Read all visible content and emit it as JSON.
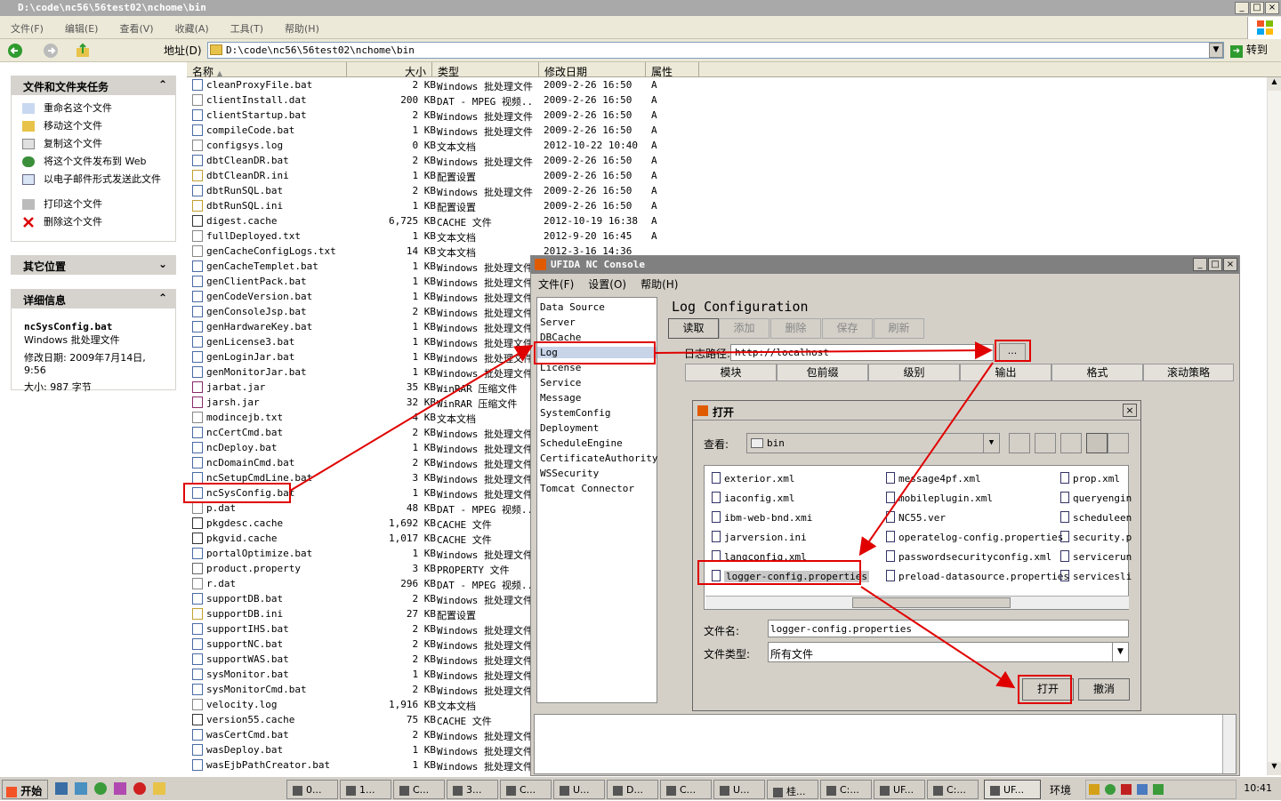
{
  "explorer": {
    "title": "D:\\code\\nc56\\56test02\\nchome\\bin",
    "menu": [
      "文件(F)",
      "编辑(E)",
      "查看(V)",
      "收藏(A)",
      "工具(T)",
      "帮助(H)"
    ],
    "address_label": "地址(D)",
    "address": "D:\\code\\nc56\\56test02\\nchome\\bin",
    "go_label": "转到",
    "tasks_title": "文件和文件夹任务",
    "tasks": [
      "重命名这个文件",
      "移动这个文件",
      "复制这个文件",
      "将这个文件发布到 Web",
      "以电子邮件形式发送此文件",
      "打印这个文件",
      "删除这个文件"
    ],
    "other_title": "其它位置",
    "details_title": "详细信息",
    "details_name": "ncSysConfig.bat",
    "details_type": "Windows 批处理文件",
    "details_modified": "修改日期: 2009年7月14日, 9:56",
    "details_size": "大小: 987 字节",
    "columns": [
      "名称",
      "大小",
      "类型",
      "修改日期",
      "属性"
    ],
    "files": [
      {
        "n": "cleanProxyFile.bat",
        "s": "2 KB",
        "t": "Windows 批处理文件",
        "d": "2009-2-26 16:50",
        "a": "A"
      },
      {
        "n": "clientInstall.dat",
        "s": "200 KB",
        "t": "DAT - MPEG 视频...",
        "d": "2009-2-26 16:50",
        "a": "A"
      },
      {
        "n": "clientStartup.bat",
        "s": "2 KB",
        "t": "Windows 批处理文件",
        "d": "2009-2-26 16:50",
        "a": "A"
      },
      {
        "n": "compileCode.bat",
        "s": "1 KB",
        "t": "Windows 批处理文件",
        "d": "2009-2-26 16:50",
        "a": "A"
      },
      {
        "n": "configsys.log",
        "s": "0 KB",
        "t": "文本文档",
        "d": "2012-10-22 10:40",
        "a": "A"
      },
      {
        "n": "dbtCleanDR.bat",
        "s": "2 KB",
        "t": "Windows 批处理文件",
        "d": "2009-2-26 16:50",
        "a": "A"
      },
      {
        "n": "dbtCleanDR.ini",
        "s": "1 KB",
        "t": "配置设置",
        "d": "2009-2-26 16:50",
        "a": "A"
      },
      {
        "n": "dbtRunSQL.bat",
        "s": "2 KB",
        "t": "Windows 批处理文件",
        "d": "2009-2-26 16:50",
        "a": "A"
      },
      {
        "n": "dbtRunSQL.ini",
        "s": "1 KB",
        "t": "配置设置",
        "d": "2009-2-26 16:50",
        "a": "A"
      },
      {
        "n": "digest.cache",
        "s": "6,725 KB",
        "t": "CACHE 文件",
        "d": "2012-10-19 16:38",
        "a": "A"
      },
      {
        "n": "fullDeployed.txt",
        "s": "1 KB",
        "t": "文本文档",
        "d": "2012-9-20 16:45",
        "a": "A"
      },
      {
        "n": "genCacheConfigLogs.txt",
        "s": "14 KB",
        "t": "文本文档",
        "d": "2012-3-16 14:36",
        "a": ""
      },
      {
        "n": "genCacheTemplet.bat",
        "s": "1 KB",
        "t": "Windows 批处理文件",
        "d": "",
        "a": ""
      },
      {
        "n": "genClientPack.bat",
        "s": "1 KB",
        "t": "Windows 批处理文件",
        "d": "",
        "a": ""
      },
      {
        "n": "genCodeVersion.bat",
        "s": "1 KB",
        "t": "Windows 批处理文件",
        "d": "",
        "a": ""
      },
      {
        "n": "genConsoleJsp.bat",
        "s": "2 KB",
        "t": "Windows 批处理文件",
        "d": "",
        "a": ""
      },
      {
        "n": "genHardwareKey.bat",
        "s": "1 KB",
        "t": "Windows 批处理文件",
        "d": "",
        "a": ""
      },
      {
        "n": "genLicense3.bat",
        "s": "1 KB",
        "t": "Windows 批处理文件",
        "d": "",
        "a": ""
      },
      {
        "n": "genLoginJar.bat",
        "s": "1 KB",
        "t": "Windows 批处理文件",
        "d": "",
        "a": ""
      },
      {
        "n": "genMonitorJar.bat",
        "s": "1 KB",
        "t": "Windows 批处理文件",
        "d": "",
        "a": ""
      },
      {
        "n": "jarbat.jar",
        "s": "35 KB",
        "t": "WinRAR 压缩文件",
        "d": "",
        "a": ""
      },
      {
        "n": "jarsh.jar",
        "s": "32 KB",
        "t": "WinRAR 压缩文件",
        "d": "",
        "a": ""
      },
      {
        "n": "modincejb.txt",
        "s": "4 KB",
        "t": "文本文档",
        "d": "",
        "a": ""
      },
      {
        "n": "ncCertCmd.bat",
        "s": "2 KB",
        "t": "Windows 批处理文件",
        "d": "",
        "a": ""
      },
      {
        "n": "ncDeploy.bat",
        "s": "1 KB",
        "t": "Windows 批处理文件",
        "d": "",
        "a": ""
      },
      {
        "n": "ncDomainCmd.bat",
        "s": "2 KB",
        "t": "Windows 批处理文件",
        "d": "",
        "a": ""
      },
      {
        "n": "ncSetupCmdLine.bat",
        "s": "3 KB",
        "t": "Windows 批处理文件",
        "d": "",
        "a": ""
      },
      {
        "n": "ncSysConfig.bat",
        "s": "1 KB",
        "t": "Windows 批处理文件",
        "d": "",
        "a": ""
      },
      {
        "n": "p.dat",
        "s": "48 KB",
        "t": "DAT - MPEG 视频...",
        "d": "",
        "a": ""
      },
      {
        "n": "pkgdesc.cache",
        "s": "1,692 KB",
        "t": "CACHE 文件",
        "d": "",
        "a": ""
      },
      {
        "n": "pkgvid.cache",
        "s": "1,017 KB",
        "t": "CACHE 文件",
        "d": "",
        "a": ""
      },
      {
        "n": "portalOptimize.bat",
        "s": "1 KB",
        "t": "Windows 批处理文件",
        "d": "",
        "a": ""
      },
      {
        "n": "product.property",
        "s": "3 KB",
        "t": "PROPERTY 文件",
        "d": "",
        "a": ""
      },
      {
        "n": "r.dat",
        "s": "296 KB",
        "t": "DAT - MPEG 视频...",
        "d": "",
        "a": ""
      },
      {
        "n": "supportDB.bat",
        "s": "2 KB",
        "t": "Windows 批处理文件",
        "d": "",
        "a": ""
      },
      {
        "n": "supportDB.ini",
        "s": "27 KB",
        "t": "配置设置",
        "d": "",
        "a": ""
      },
      {
        "n": "supportIHS.bat",
        "s": "2 KB",
        "t": "Windows 批处理文件",
        "d": "",
        "a": ""
      },
      {
        "n": "supportNC.bat",
        "s": "2 KB",
        "t": "Windows 批处理文件",
        "d": "",
        "a": ""
      },
      {
        "n": "supportWAS.bat",
        "s": "2 KB",
        "t": "Windows 批处理文件",
        "d": "",
        "a": ""
      },
      {
        "n": "sysMonitor.bat",
        "s": "1 KB",
        "t": "Windows 批处理文件",
        "d": "",
        "a": ""
      },
      {
        "n": "sysMonitorCmd.bat",
        "s": "2 KB",
        "t": "Windows 批处理文件",
        "d": "",
        "a": ""
      },
      {
        "n": "velocity.log",
        "s": "1,916 KB",
        "t": "文本文档",
        "d": "",
        "a": ""
      },
      {
        "n": "version55.cache",
        "s": "75 KB",
        "t": "CACHE 文件",
        "d": "",
        "a": ""
      },
      {
        "n": "wasCertCmd.bat",
        "s": "2 KB",
        "t": "Windows 批处理文件",
        "d": "",
        "a": ""
      },
      {
        "n": "wasDeploy.bat",
        "s": "1 KB",
        "t": "Windows 批处理文件",
        "d": "",
        "a": ""
      },
      {
        "n": "wasEjbPathCreator.bat",
        "s": "1 KB",
        "t": "Windows 批处理文件",
        "d": "",
        "a": ""
      }
    ]
  },
  "console": {
    "title": "UFIDA NC Console",
    "menu": [
      "文件(F)",
      "设置(O)",
      "帮助(H)"
    ],
    "nav": [
      "Data Source",
      "Server",
      "DBCache",
      "Log",
      "License",
      "Service",
      "Message",
      "SystemConfig",
      "Deployment",
      "ScheduleEngine",
      "CertificateAuthority",
      "WSSecurity",
      "Tomcat Connector"
    ],
    "heading": "Log Configuration",
    "buttons": [
      "读取",
      "添加",
      "删除",
      "保存",
      "刷新"
    ],
    "path_label": "日志路径:",
    "path_value": "http://localhost",
    "browse_label": "...",
    "grid_columns": [
      "模块",
      "包前缀",
      "级别",
      "输出",
      "格式",
      "滚动策略"
    ]
  },
  "open_dialog": {
    "title": "打开",
    "look_in_label": "查看:",
    "look_in_value": "bin",
    "files": [
      "exterior.xml",
      "iaconfig.xml",
      "ibm-web-bnd.xmi",
      "jarversion.ini",
      "langconfig.xml",
      "logger-config.properties",
      "message4pf.xml",
      "mobileplugin.xml",
      "NC55.ver",
      "operatelog-config.properties",
      "passwordsecurityconfig.xml",
      "preload-datasource.properties",
      "prop.xml",
      "queryengin",
      "scheduleen",
      "security.p",
      "servicerun",
      "servicesli"
    ],
    "filename_label": "文件名:",
    "filename_value": "logger-config.properties",
    "filetype_label": "文件类型:",
    "filetype_value": "所有文件",
    "open_label": "打开",
    "cancel_label": "撤消"
  },
  "taskbar": {
    "start_label": "开始",
    "items": [
      "0...",
      "1...",
      "C...",
      "3...",
      "C...",
      "U...",
      "D...",
      "C...",
      "U...",
      "桂...",
      "C:...",
      "UF...",
      "C:...",
      "UF..."
    ],
    "env_label": "环境",
    "clock": "10:41"
  },
  "colors": {
    "highlight": "#e00000",
    "title_inactive": "#a9a9a9",
    "console_title": "#808080"
  }
}
